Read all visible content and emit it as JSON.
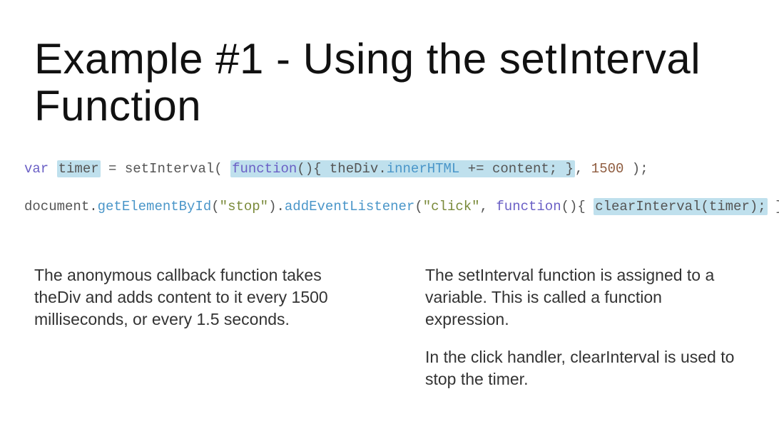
{
  "title": "Example #1 - Using the setInterval Function",
  "code": {
    "line1": {
      "t1": "var",
      "t2": "timer",
      "t3": " = setInterval( ",
      "t4": "function",
      "t5": "(){ theDiv.",
      "t6": "innerHTML",
      "t7": " += content; }",
      "t8": ", ",
      "t9": "1500",
      "t10": " );"
    },
    "line2": {
      "t1": "document.",
      "t2": "getElementById",
      "t3": "(",
      "t4": "\"stop\"",
      "t5": ").",
      "t6": "addEventListener",
      "t7": "(",
      "t8": "\"click\"",
      "t9": ", ",
      "t10": "function",
      "t11": "(){ ",
      "t12": "clearInterval(timer);",
      "t13": " });"
    }
  },
  "left": {
    "p1": "The anonymous callback function takes theDiv and adds content to it every 1500 milliseconds, or every 1.5 seconds."
  },
  "right": {
    "p1": "The setInterval function is assigned to a variable. This is called a function expression.",
    "p2": "In the click handler, clearInterval is used to stop the timer."
  }
}
